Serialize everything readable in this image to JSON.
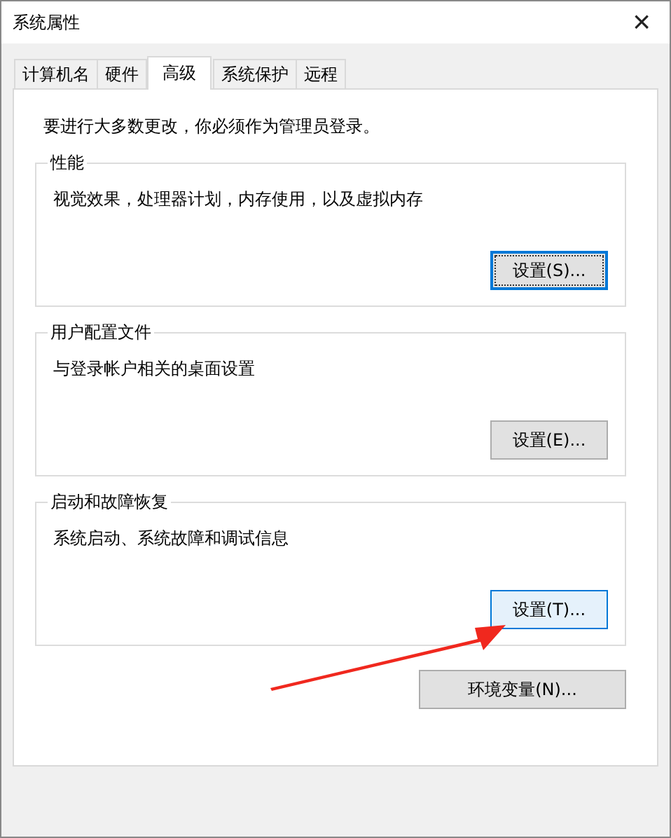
{
  "window": {
    "title": "系统属性",
    "close": "×"
  },
  "tabs": [
    {
      "label": "计算机名",
      "selected": false
    },
    {
      "label": "硬件",
      "selected": false
    },
    {
      "label": "高级",
      "selected": true
    },
    {
      "label": "系统保护",
      "selected": false
    },
    {
      "label": "远程",
      "selected": false
    }
  ],
  "notice": "要进行大多数更改，你必须作为管理员登录。",
  "groups": [
    {
      "title": "性能",
      "description": "视觉效果，处理器计划，内存使用，以及虚拟内存",
      "button": {
        "label": "设置(S)...",
        "focused": true,
        "hovered": false
      }
    },
    {
      "title": "用户配置文件",
      "description": "与登录帐户相关的桌面设置",
      "button": {
        "label": "设置(E)...",
        "focused": false,
        "hovered": false
      }
    },
    {
      "title": "启动和故障恢复",
      "description": "系统启动、系统故障和调试信息",
      "button": {
        "label": "设置(T)...",
        "focused": false,
        "hovered": true
      }
    }
  ],
  "env_button": {
    "label": "环境变量(N)...",
    "focused": false,
    "hovered": false
  }
}
